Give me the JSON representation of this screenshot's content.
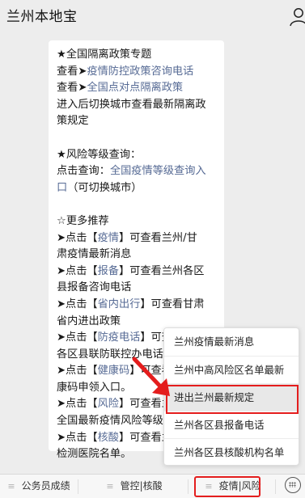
{
  "header": {
    "title": "兰州本地宝"
  },
  "message": {
    "lines": [
      {
        "parts": [
          {
            "t": "★全国隔离政策专题",
            "link": false
          }
        ]
      },
      {
        "parts": [
          {
            "t": "查看➤",
            "link": false
          },
          {
            "t": "疫情防控政策咨询电话",
            "link": true
          }
        ]
      },
      {
        "parts": [
          {
            "t": "查看➤",
            "link": false
          },
          {
            "t": "全国点对点隔离政策",
            "link": true
          }
        ]
      },
      {
        "parts": [
          {
            "t": "进入后切换城市查看最新隔离政",
            "link": false
          }
        ]
      },
      {
        "parts": [
          {
            "t": "策规定",
            "link": false
          }
        ]
      },
      {
        "gap": true
      },
      {
        "parts": [
          {
            "t": "★风险等级查询：",
            "link": false
          }
        ]
      },
      {
        "parts": [
          {
            "t": "点击查询：",
            "link": false
          },
          {
            "t": "全国疫情等级查询入",
            "link": true
          }
        ]
      },
      {
        "parts": [
          {
            "t": "口",
            "link": true
          },
          {
            "t": "（可切换城市）",
            "link": false
          }
        ]
      },
      {
        "gap": true
      },
      {
        "parts": [
          {
            "t": "☆更多推荐",
            "link": false
          }
        ]
      },
      {
        "parts": [
          {
            "t": "➤点击【",
            "link": false
          },
          {
            "t": "疫情",
            "link": true
          },
          {
            "t": "】可查看兰州/甘",
            "link": false
          }
        ]
      },
      {
        "parts": [
          {
            "t": "肃疫情最新消息",
            "link": false
          }
        ]
      },
      {
        "parts": [
          {
            "t": "➤点击【",
            "link": false
          },
          {
            "t": "报备",
            "link": true
          },
          {
            "t": "】可查看兰州各区",
            "link": false
          }
        ]
      },
      {
        "parts": [
          {
            "t": "县报备咨询电话",
            "link": false
          }
        ]
      },
      {
        "parts": [
          {
            "t": "➤点击【",
            "link": false
          },
          {
            "t": "省内出行",
            "link": true
          },
          {
            "t": "】可查看甘肃",
            "link": false
          }
        ]
      },
      {
        "parts": [
          {
            "t": "省内进出政策",
            "link": false
          }
        ]
      },
      {
        "parts": [
          {
            "t": "➤点击【",
            "link": false
          },
          {
            "t": "防疫电话",
            "link": true
          },
          {
            "t": "】可查看甘肃",
            "link": false
          }
        ]
      },
      {
        "parts": [
          {
            "t": "各区县联防联控办电话",
            "link": false
          }
        ]
      },
      {
        "parts": [
          {
            "t": "➤点击【",
            "link": false
          },
          {
            "t": "健康码",
            "link": true
          },
          {
            "t": "】可查看甘肃健",
            "link": false
          }
        ]
      },
      {
        "parts": [
          {
            "t": "康码申领入口。",
            "link": false
          }
        ]
      },
      {
        "parts": [
          {
            "t": "➤点击【",
            "link": false
          },
          {
            "t": "风险",
            "link": true
          },
          {
            "t": "】可查看兰州/",
            "link": false
          }
        ]
      },
      {
        "parts": [
          {
            "t": "全国最新疫情风险等级",
            "link": false
          }
        ]
      },
      {
        "parts": [
          {
            "t": "➤点击【",
            "link": false
          },
          {
            "t": "核酸",
            "link": true
          },
          {
            "t": "】可查看兰州核酸",
            "link": false
          }
        ]
      },
      {
        "parts": [
          {
            "t": "检测医院名单。",
            "link": false
          }
        ]
      }
    ]
  },
  "popup": {
    "items": [
      {
        "label": "兰州疫情最新消息"
      },
      {
        "label": "兰州中高风险区名单最新"
      },
      {
        "label": "进出兰州最新规定"
      },
      {
        "label": "兰州各区县报备电话"
      },
      {
        "label": "兰州各区县核酸机构名单"
      }
    ],
    "highlighted_index": 2
  },
  "bottom_bar": {
    "tabs": [
      {
        "label": "公务员成绩"
      },
      {
        "label": "管控|核酸"
      },
      {
        "label": "疫情|风险"
      }
    ],
    "menu_icon_glyph": "≡",
    "active_tab_index": 2
  },
  "annotations": {
    "highlight_color": "#e41d1d",
    "arrow_color": "#e41d1d"
  }
}
